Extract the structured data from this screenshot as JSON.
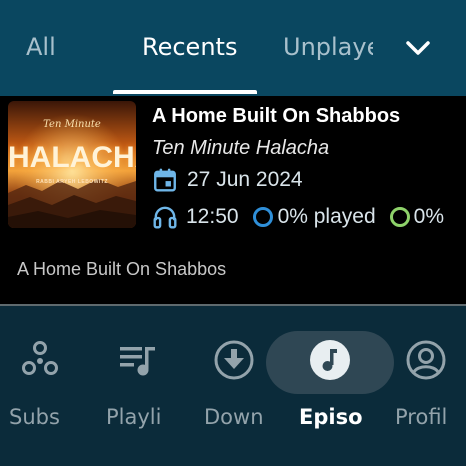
{
  "tabs": [
    {
      "label": "All"
    },
    {
      "label": "Recents"
    },
    {
      "label": "Unplaye"
    }
  ],
  "episode": {
    "title": "A Home Built On Shabbos",
    "podcast": "Ten Minute Halacha",
    "date": "27 Jun 2024",
    "duration": "12:50",
    "played": "0% played",
    "played2": "0%",
    "description": "A Home Built On Shabbos",
    "artwork": {
      "line1": "Ten Minute",
      "line2": "HALACHA",
      "line3": "RABBI ARYEH LEBOWITZ"
    }
  },
  "nav": [
    {
      "label": "Subs",
      "icon": "podcasts-icon"
    },
    {
      "label": "Playli",
      "icon": "playlist-icon"
    },
    {
      "label": "Down",
      "icon": "download-icon"
    },
    {
      "label": "Episo",
      "icon": "music-note-icon"
    },
    {
      "label": "Profil",
      "icon": "profile-icon"
    }
  ],
  "colors": {
    "topbar": "#0a4760",
    "bottomnav": "#0b2b3a",
    "active_pill": "#2f4754",
    "progress_blue": "#2f8fd8",
    "progress_green": "#8ed26a"
  }
}
